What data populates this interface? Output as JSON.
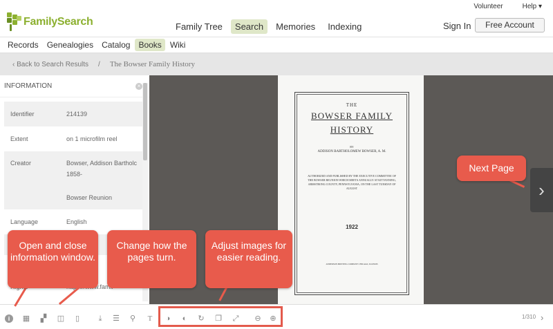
{
  "header": {
    "logo_text": "FamilySearch",
    "nav": [
      "Family Tree",
      "Search",
      "Memories",
      "Indexing"
    ],
    "active_nav": "Search",
    "util_links": [
      "Volunteer",
      "Help ▾"
    ],
    "sign_in": "Sign In",
    "free_account": "Free Account"
  },
  "subnav": {
    "items": [
      "Records",
      "Genealogies",
      "Catalog",
      "Books",
      "Wiki"
    ],
    "active": "Books"
  },
  "breadcrumb": {
    "back": "‹ Back to Search Results",
    "separator": "/",
    "current": "The Bowser Family History"
  },
  "info_panel": {
    "title": "INFORMATION",
    "rows": [
      {
        "label": "Identifier",
        "value": "214139"
      },
      {
        "label": "Extent",
        "value": "on 1 microfilm reel"
      },
      {
        "label": "Creator",
        "value": "Bowser, Addison Bartholc"
      },
      {
        "label": "",
        "value": "1858-"
      },
      {
        "label": "",
        "value": "Bowser Reunion"
      },
      {
        "label": "Language",
        "value": "English"
      },
      {
        "label": "Rights",
        "value": "https://www.famil"
      }
    ]
  },
  "book_page": {
    "the": "THE",
    "title_line1": "BOWSER FAMILY",
    "title_line2": "HISTORY",
    "by": "BY",
    "author": "ADDISON BARTHOLOMEW BOWSER, A. M.",
    "publication": "AUTHORIZED AND PUBLISHED BY THE EXECUTIVE COMMITTEE OF THE BOWSER REUNION WHICH MEETS ANNUALLY AT KITTANNING, ARMSTRONG COUNTY, PENNSYLVANIA, ON THE LAST TUESDAY OF AUGUST",
    "mark": "1922",
    "printer": "ANDERSON PRINTING COMPANY CHICAGO, ILLINOIS"
  },
  "toolbar": {
    "page_count": "1/310",
    "icons": [
      "info-icon",
      "grid-icon",
      "thumbnails-icon",
      "two-page-icon",
      "single-page-icon",
      "download-icon",
      "list-icon",
      "search-icon",
      "text-icon",
      "invert-icon",
      "contrast-icon",
      "rotate-icon",
      "copy-icon",
      "fullscreen-icon",
      "zoom-out-icon",
      "zoom-in-icon"
    ]
  },
  "callouts": {
    "info": "Open and close information window.",
    "turn": "Change how the pages turn.",
    "adjust": "Adjust images for easier reading.",
    "next": "Next Page"
  },
  "colors": {
    "brand_green": "#8cb030",
    "callout_red": "#e85b4c",
    "viewer_bg": "#5c5956"
  }
}
